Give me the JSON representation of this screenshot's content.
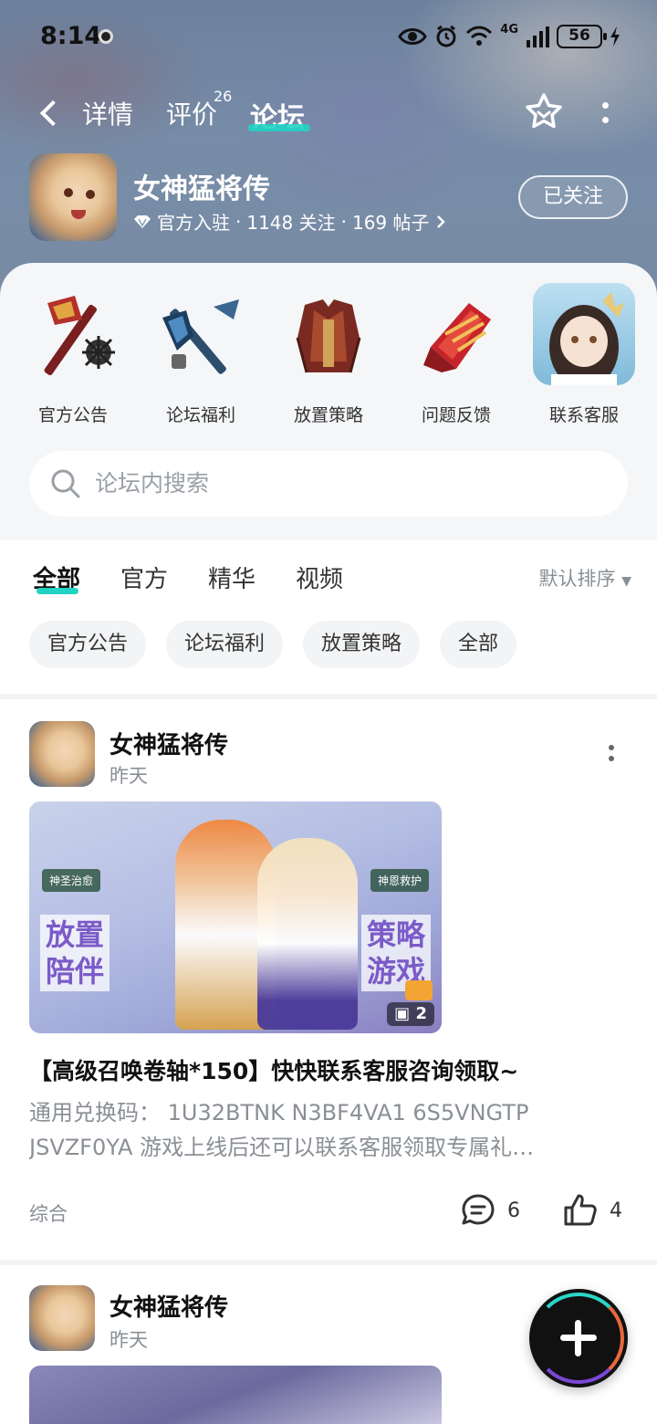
{
  "status_bar": {
    "time": "8:14",
    "battery": "56",
    "network": "4G"
  },
  "nav": {
    "tabs": [
      {
        "label": "详情",
        "active": false
      },
      {
        "label": "评价",
        "badge": "26",
        "active": false
      },
      {
        "label": "论坛",
        "active": true
      }
    ],
    "accent_color": "#21d3c3"
  },
  "game": {
    "title": "女神猛将传",
    "official": "官方入驻",
    "followers": "1148 关注",
    "posts": "169 帖子",
    "follow_label": "已关注"
  },
  "shortcuts": [
    {
      "label": "官方公告",
      "icon": "axe-icon"
    },
    {
      "label": "论坛福利",
      "icon": "hammer-icon"
    },
    {
      "label": "放置策略",
      "icon": "armor-icon"
    },
    {
      "label": "问题反馈",
      "icon": "gauntlet-icon"
    },
    {
      "label": "联系客服",
      "icon": "support-avatar-icon"
    }
  ],
  "search": {
    "placeholder": "论坛内搜索"
  },
  "feed_tabs": [
    "全部",
    "官方",
    "精华",
    "视频"
  ],
  "sort_label": "默认排序",
  "chips": [
    "官方公告",
    "论坛福利",
    "放置策略",
    "全部"
  ],
  "posts": [
    {
      "author": "女神猛将传",
      "time": "昨天",
      "image_text_left": "放置\n陪伴",
      "image_text_right": "策略\n游戏",
      "image_badge_left": "神圣治愈",
      "image_badge_right": "神恩救护",
      "image_count": "2",
      "title": "【高级召唤卷轴*150】快快联系客服咨询领取~",
      "body_line1": "通用兑换码：  1U32BTNK N3BF4VA1 6S5VNGTP",
      "body_line2": "JSVZF0YA 游戏上线后还可以联系客服领取专属礼…",
      "tag": "综合",
      "comments": "6",
      "likes": "4"
    },
    {
      "author": "女神猛将传",
      "time": "昨天"
    }
  ]
}
